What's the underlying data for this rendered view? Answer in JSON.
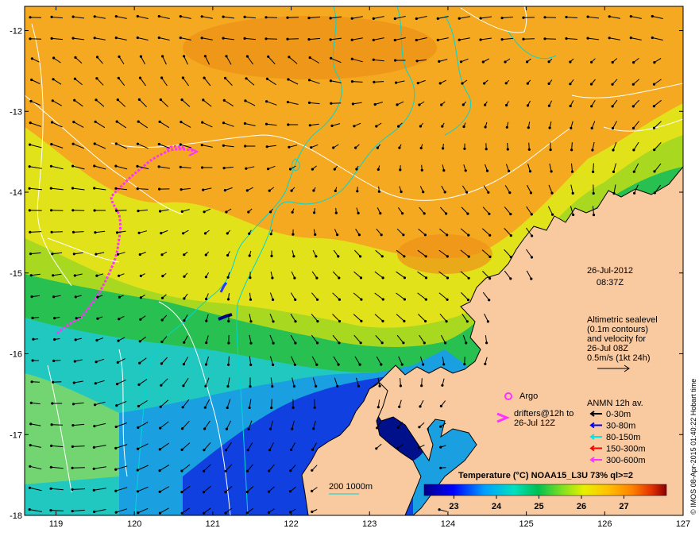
{
  "map": {
    "lon_ticks": [
      "119",
      "120",
      "121",
      "122",
      "123",
      "124",
      "125",
      "126",
      "127"
    ],
    "lat_ticks": [
      "-12",
      "-13",
      "-14",
      "-15",
      "-16",
      "-17",
      "-18"
    ],
    "lon_range": [
      118.6,
      127
    ],
    "lat_range": [
      -18,
      -11.7
    ]
  },
  "colors": {
    "land": "#f9c9a0",
    "coastline": "#000000",
    "bathymetry_contour": "#00d6d6",
    "sealevel_contour": "#ffffff",
    "drifter": "#ff33ff",
    "vector_0_30": "#000000",
    "vector_30_80": "#0000ee",
    "vector_80_150": "#00e5e5",
    "vector_150_300": "#ff0000",
    "vector_300_600": "#ff33ff"
  },
  "annotations": {
    "date": "26-Jul-2012",
    "time": "08:37Z",
    "altimetry": [
      "Altimetric sealevel",
      "(0.1m contours)",
      "and velocity for",
      "26-Jul 08Z",
      "0.5m/s (1kt 24h)"
    ],
    "argo": "Argo",
    "drifters": [
      "drifters@12h to",
      "26-Jul 12Z"
    ],
    "bathymetry": "200  1000m",
    "credit": "© IMOS 08-Apr-2015 01:40:22 Hobart time"
  },
  "anmn_legend": {
    "title": "ANMN 12h av.",
    "items": [
      "0-30m",
      "30-80m",
      "80-150m",
      "150-300m",
      "300-600m"
    ]
  },
  "colorbar": {
    "title": "Temperature (°C) NOAA15_L3U 73% ql>=2",
    "range": [
      22.3,
      28.0
    ],
    "ticks": [
      "23",
      "24",
      "25",
      "26",
      "27"
    ],
    "tick_values": [
      23,
      24,
      25,
      26,
      27
    ]
  }
}
